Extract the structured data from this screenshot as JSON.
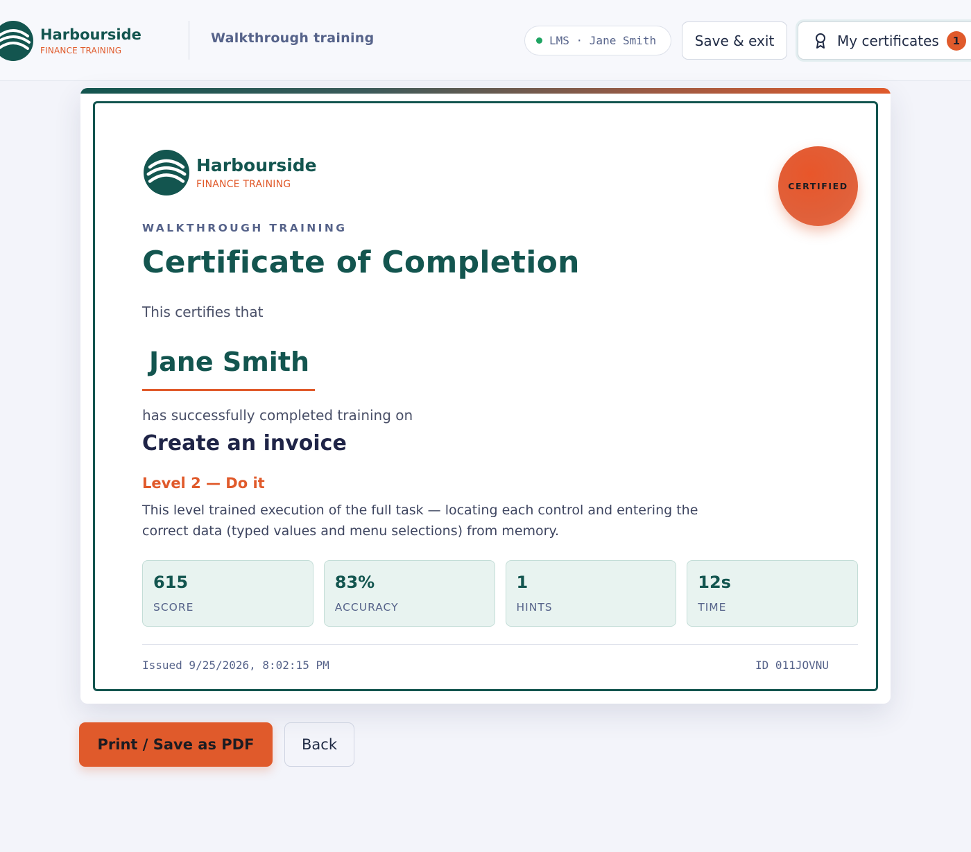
{
  "header": {
    "brand_name": "Harbourside",
    "brand_sub": "FINANCE TRAINING",
    "title": "Walkthrough training",
    "lms_status": "LMS · Jane Smith",
    "save_exit_label": "Save & exit",
    "certificates_label": "My certificates",
    "certificates_count": "1"
  },
  "certificate": {
    "brand_name": "Harbourside",
    "brand_sub": "FINANCE TRAINING",
    "seal_text": "CERTIFIED",
    "overline": "WALKTHROUGH TRAINING",
    "title": "Certificate of Completion",
    "certifies_text": "This certifies that",
    "recipient": "Jane Smith",
    "completed_text": "has successfully completed training on",
    "course": "Create an invoice",
    "level": "Level 2 — Do it",
    "level_description": "This level trained execution of the full task — locating each control and entering the correct data (typed values and menu selections) from memory.",
    "stats": [
      {
        "value": "615",
        "label": "SCORE"
      },
      {
        "value": "83%",
        "label": "ACCURACY"
      },
      {
        "value": "1",
        "label": "HINTS"
      },
      {
        "value": "12s",
        "label": "TIME"
      }
    ],
    "issued": "Issued 9/25/2026, 8:02:15 PM",
    "id": "ID 011JOVNU"
  },
  "actions": {
    "print_label": "Print / Save as PDF",
    "back_label": "Back"
  },
  "colors": {
    "brand_teal": "#13554f",
    "accent_orange": "#e05a2b",
    "status_green": "#1fa463"
  }
}
